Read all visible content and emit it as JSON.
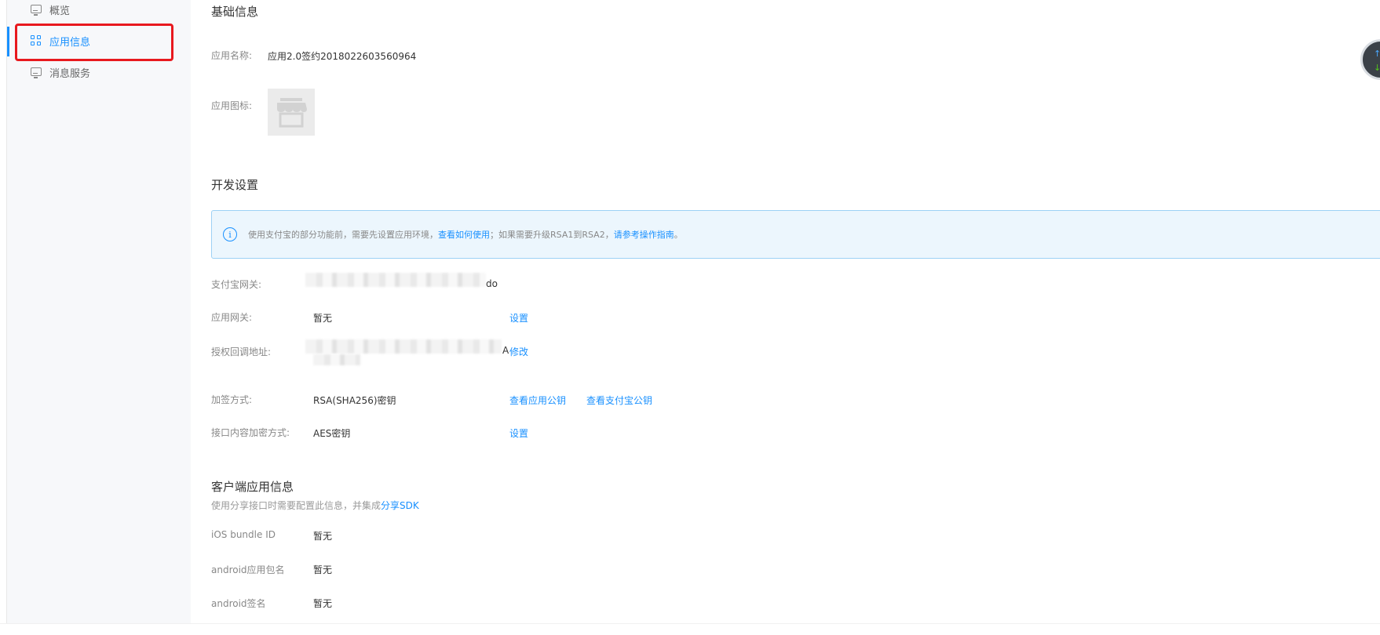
{
  "sidebar": {
    "items": [
      {
        "label": "概览",
        "icon": "monitor-icon"
      },
      {
        "label": "应用信息",
        "icon": "grid-icon",
        "active": true
      },
      {
        "label": "消息服务",
        "icon": "monitor-icon"
      }
    ]
  },
  "basic_info": {
    "title": "基础信息",
    "app_name_label": "应用名称:",
    "app_name_value": "应用2.0签约2018022603560964",
    "app_icon_label": "应用图标:"
  },
  "dev_settings": {
    "title": "开发设置",
    "banner": {
      "text_before": "使用支付宝的部分功能前，需要先设置应用环境，",
      "link1": "查看如何使用",
      "text_middle": "；如果需要升级RSA1到RSA2，",
      "link2": "请参考操作指南",
      "text_after": "。"
    },
    "gateway_label": "支付宝网关:",
    "gateway_value_tail": "do",
    "app_gateway_label": "应用网关:",
    "app_gateway_value": "暂无",
    "app_gateway_action": "设置",
    "callback_label": "授权回调地址:",
    "callback_value_tail": "A",
    "callback_action": "修改",
    "sign_label": "加签方式:",
    "sign_value": "RSA(SHA256)密钥",
    "sign_action1": "查看应用公钥",
    "sign_action2": "查看支付宝公钥",
    "encrypt_label": "接口内容加密方式:",
    "encrypt_value": "AES密钥",
    "encrypt_action": "设置"
  },
  "client_info": {
    "title": "客户端应用信息",
    "subtitle_prefix": "使用分享接口时需要配置此信息，并集成",
    "subtitle_link": "分享SDK",
    "ios_label": "iOS bundle ID",
    "ios_value": "暂无",
    "android_pkg_label": "android应用包名",
    "android_pkg_value": "暂无",
    "android_sign_label": "android签名",
    "android_sign_value": "暂无"
  },
  "colors": {
    "accent": "#1890ff",
    "highlight": "#e8191e",
    "banner_bg": "#ecf6fd"
  }
}
